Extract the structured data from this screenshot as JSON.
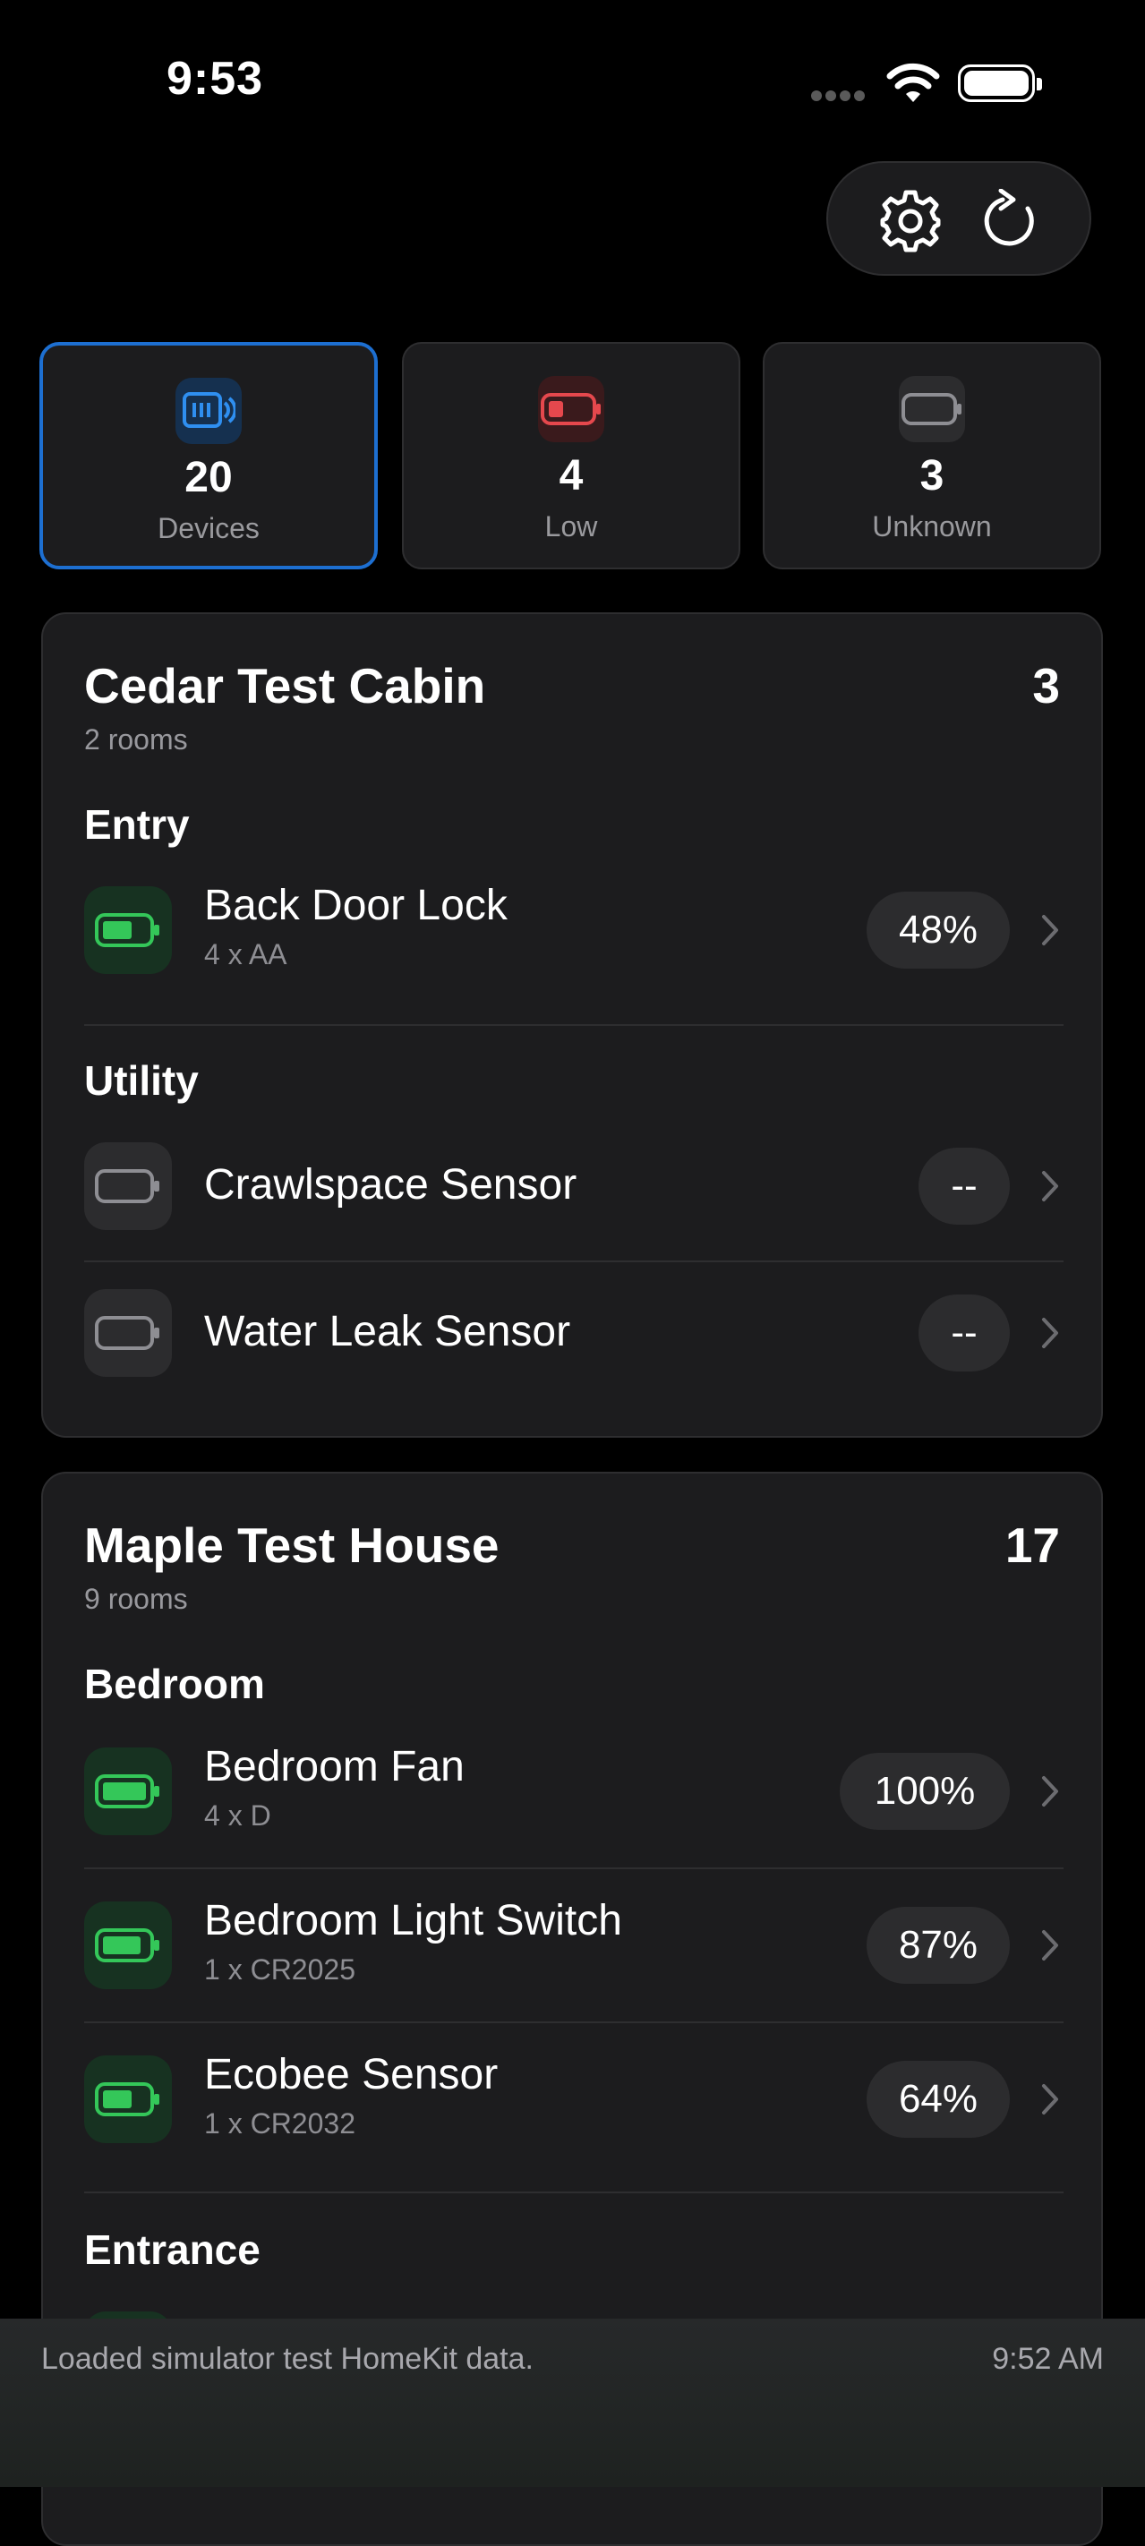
{
  "status_bar": {
    "time": "9:53"
  },
  "summary": [
    {
      "value": "20",
      "label": "Devices",
      "icon": "devices-icon",
      "color": "#2f8ff0"
    },
    {
      "value": "4",
      "label": "Low",
      "icon": "battery-low-icon",
      "color": "#e5484d"
    },
    {
      "value": "3",
      "label": "Unknown",
      "icon": "battery-unknown-icon",
      "color": "#8e8e93"
    }
  ],
  "homes": [
    {
      "name": "Cedar Test Cabin",
      "count": "3",
      "rooms_label": "2 rooms",
      "rooms": [
        {
          "name": "Entry",
          "devices": [
            {
              "name": "Back Door Lock",
              "spec": "4 x AA",
              "level": "48%",
              "status": "green"
            }
          ]
        },
        {
          "name": "Utility",
          "devices": [
            {
              "name": "Crawlspace Sensor",
              "spec": "",
              "level": "--",
              "status": "gray"
            },
            {
              "name": "Water Leak Sensor",
              "spec": "",
              "level": "--",
              "status": "gray"
            }
          ]
        }
      ]
    },
    {
      "name": "Maple Test House",
      "count": "17",
      "rooms_label": "9 rooms",
      "rooms": [
        {
          "name": "Bedroom",
          "devices": [
            {
              "name": "Bedroom Fan",
              "spec": "4 x D",
              "level": "100%",
              "status": "green"
            },
            {
              "name": "Bedroom Light Switch",
              "spec": "1 x CR2025",
              "level": "87%",
              "status": "green"
            },
            {
              "name": "Ecobee Sensor",
              "spec": "1 x CR2032",
              "level": "64%",
              "status": "green"
            }
          ]
        },
        {
          "name": "Entrance",
          "devices": []
        }
      ]
    }
  ],
  "toast": {
    "message": "Loaded simulator test HomeKit data.",
    "time": "9:52 AM"
  },
  "colors": {
    "accent": "#1d6fd1",
    "battery_ok": "#34c759",
    "battery_low": "#e5484d",
    "card": "#1c1c1e"
  }
}
